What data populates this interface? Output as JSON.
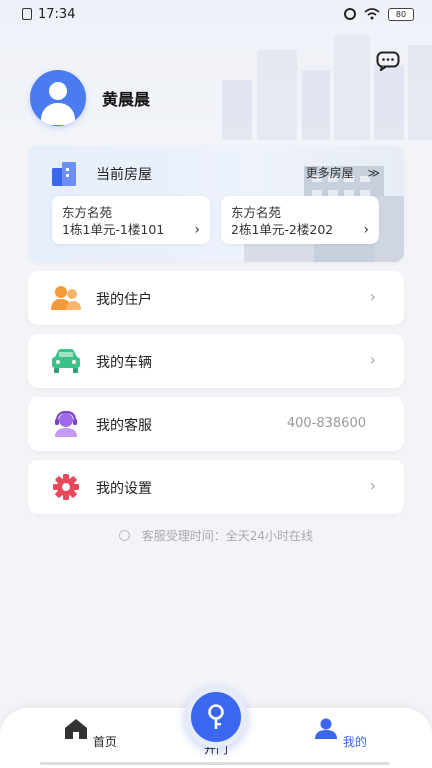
{
  "status_bar": {
    "time": "17:34",
    "battery": "80"
  },
  "profile": {
    "name": "黄晨晨"
  },
  "houses": {
    "title": "当前房屋",
    "more_label": "更多房屋",
    "more_arrow": "≫",
    "items": [
      {
        "community": "东方名苑",
        "unit": "1栋1单元-1楼101"
      },
      {
        "community": "东方名苑",
        "unit": "2栋1单元-2楼202"
      }
    ]
  },
  "menu": [
    {
      "label": "我的住户",
      "icon": "residents-icon",
      "value": ""
    },
    {
      "label": "我的车辆",
      "icon": "car-icon",
      "value": ""
    },
    {
      "label": "我的客服",
      "icon": "customer-service-icon",
      "value": "400-838600"
    },
    {
      "label": "我的设置",
      "icon": "settings-gear-icon",
      "value": ""
    }
  ],
  "hint": "客服受理时间：全天24小时在线",
  "tabs": {
    "home": "首页",
    "door": "开门",
    "mine": "我的"
  },
  "colors": {
    "accent": "#3a66f0",
    "orange": "#f39a3c",
    "green": "#3bc28a",
    "purple": "#a06be8",
    "red": "#e9485a"
  }
}
